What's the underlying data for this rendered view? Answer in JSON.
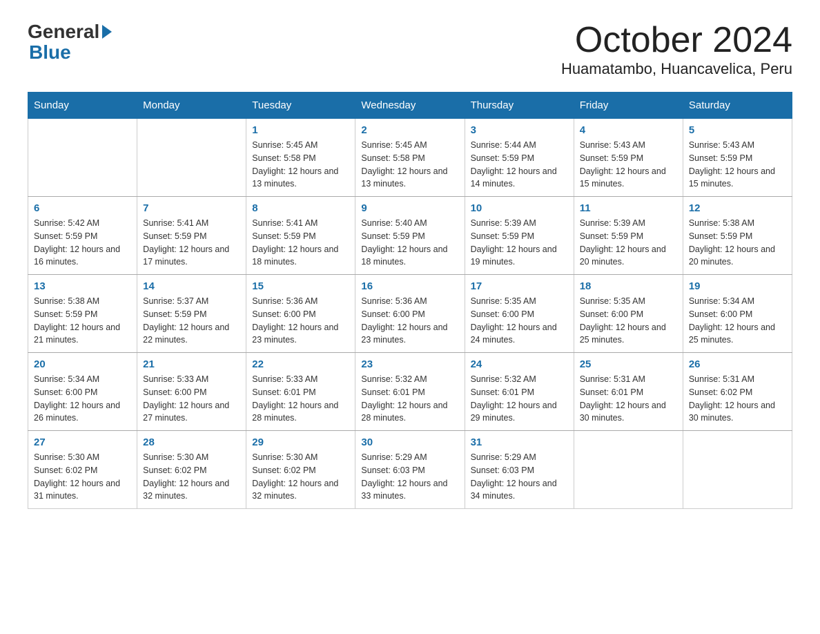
{
  "header": {
    "logo_general": "General",
    "logo_blue": "Blue",
    "month_title": "October 2024",
    "location": "Huamatambo, Huancavelica, Peru"
  },
  "days_of_week": [
    "Sunday",
    "Monday",
    "Tuesday",
    "Wednesday",
    "Thursday",
    "Friday",
    "Saturday"
  ],
  "weeks": [
    [
      {
        "day": "",
        "info": ""
      },
      {
        "day": "",
        "info": ""
      },
      {
        "day": "1",
        "info": "Sunrise: 5:45 AM\nSunset: 5:58 PM\nDaylight: 12 hours and 13 minutes."
      },
      {
        "day": "2",
        "info": "Sunrise: 5:45 AM\nSunset: 5:58 PM\nDaylight: 12 hours and 13 minutes."
      },
      {
        "day": "3",
        "info": "Sunrise: 5:44 AM\nSunset: 5:59 PM\nDaylight: 12 hours and 14 minutes."
      },
      {
        "day": "4",
        "info": "Sunrise: 5:43 AM\nSunset: 5:59 PM\nDaylight: 12 hours and 15 minutes."
      },
      {
        "day": "5",
        "info": "Sunrise: 5:43 AM\nSunset: 5:59 PM\nDaylight: 12 hours and 15 minutes."
      }
    ],
    [
      {
        "day": "6",
        "info": "Sunrise: 5:42 AM\nSunset: 5:59 PM\nDaylight: 12 hours and 16 minutes."
      },
      {
        "day": "7",
        "info": "Sunrise: 5:41 AM\nSunset: 5:59 PM\nDaylight: 12 hours and 17 minutes."
      },
      {
        "day": "8",
        "info": "Sunrise: 5:41 AM\nSunset: 5:59 PM\nDaylight: 12 hours and 18 minutes."
      },
      {
        "day": "9",
        "info": "Sunrise: 5:40 AM\nSunset: 5:59 PM\nDaylight: 12 hours and 18 minutes."
      },
      {
        "day": "10",
        "info": "Sunrise: 5:39 AM\nSunset: 5:59 PM\nDaylight: 12 hours and 19 minutes."
      },
      {
        "day": "11",
        "info": "Sunrise: 5:39 AM\nSunset: 5:59 PM\nDaylight: 12 hours and 20 minutes."
      },
      {
        "day": "12",
        "info": "Sunrise: 5:38 AM\nSunset: 5:59 PM\nDaylight: 12 hours and 20 minutes."
      }
    ],
    [
      {
        "day": "13",
        "info": "Sunrise: 5:38 AM\nSunset: 5:59 PM\nDaylight: 12 hours and 21 minutes."
      },
      {
        "day": "14",
        "info": "Sunrise: 5:37 AM\nSunset: 5:59 PM\nDaylight: 12 hours and 22 minutes."
      },
      {
        "day": "15",
        "info": "Sunrise: 5:36 AM\nSunset: 6:00 PM\nDaylight: 12 hours and 23 minutes."
      },
      {
        "day": "16",
        "info": "Sunrise: 5:36 AM\nSunset: 6:00 PM\nDaylight: 12 hours and 23 minutes."
      },
      {
        "day": "17",
        "info": "Sunrise: 5:35 AM\nSunset: 6:00 PM\nDaylight: 12 hours and 24 minutes."
      },
      {
        "day": "18",
        "info": "Sunrise: 5:35 AM\nSunset: 6:00 PM\nDaylight: 12 hours and 25 minutes."
      },
      {
        "day": "19",
        "info": "Sunrise: 5:34 AM\nSunset: 6:00 PM\nDaylight: 12 hours and 25 minutes."
      }
    ],
    [
      {
        "day": "20",
        "info": "Sunrise: 5:34 AM\nSunset: 6:00 PM\nDaylight: 12 hours and 26 minutes."
      },
      {
        "day": "21",
        "info": "Sunrise: 5:33 AM\nSunset: 6:00 PM\nDaylight: 12 hours and 27 minutes."
      },
      {
        "day": "22",
        "info": "Sunrise: 5:33 AM\nSunset: 6:01 PM\nDaylight: 12 hours and 28 minutes."
      },
      {
        "day": "23",
        "info": "Sunrise: 5:32 AM\nSunset: 6:01 PM\nDaylight: 12 hours and 28 minutes."
      },
      {
        "day": "24",
        "info": "Sunrise: 5:32 AM\nSunset: 6:01 PM\nDaylight: 12 hours and 29 minutes."
      },
      {
        "day": "25",
        "info": "Sunrise: 5:31 AM\nSunset: 6:01 PM\nDaylight: 12 hours and 30 minutes."
      },
      {
        "day": "26",
        "info": "Sunrise: 5:31 AM\nSunset: 6:02 PM\nDaylight: 12 hours and 30 minutes."
      }
    ],
    [
      {
        "day": "27",
        "info": "Sunrise: 5:30 AM\nSunset: 6:02 PM\nDaylight: 12 hours and 31 minutes."
      },
      {
        "day": "28",
        "info": "Sunrise: 5:30 AM\nSunset: 6:02 PM\nDaylight: 12 hours and 32 minutes."
      },
      {
        "day": "29",
        "info": "Sunrise: 5:30 AM\nSunset: 6:02 PM\nDaylight: 12 hours and 32 minutes."
      },
      {
        "day": "30",
        "info": "Sunrise: 5:29 AM\nSunset: 6:03 PM\nDaylight: 12 hours and 33 minutes."
      },
      {
        "day": "31",
        "info": "Sunrise: 5:29 AM\nSunset: 6:03 PM\nDaylight: 12 hours and 34 minutes."
      },
      {
        "day": "",
        "info": ""
      },
      {
        "day": "",
        "info": ""
      }
    ]
  ]
}
